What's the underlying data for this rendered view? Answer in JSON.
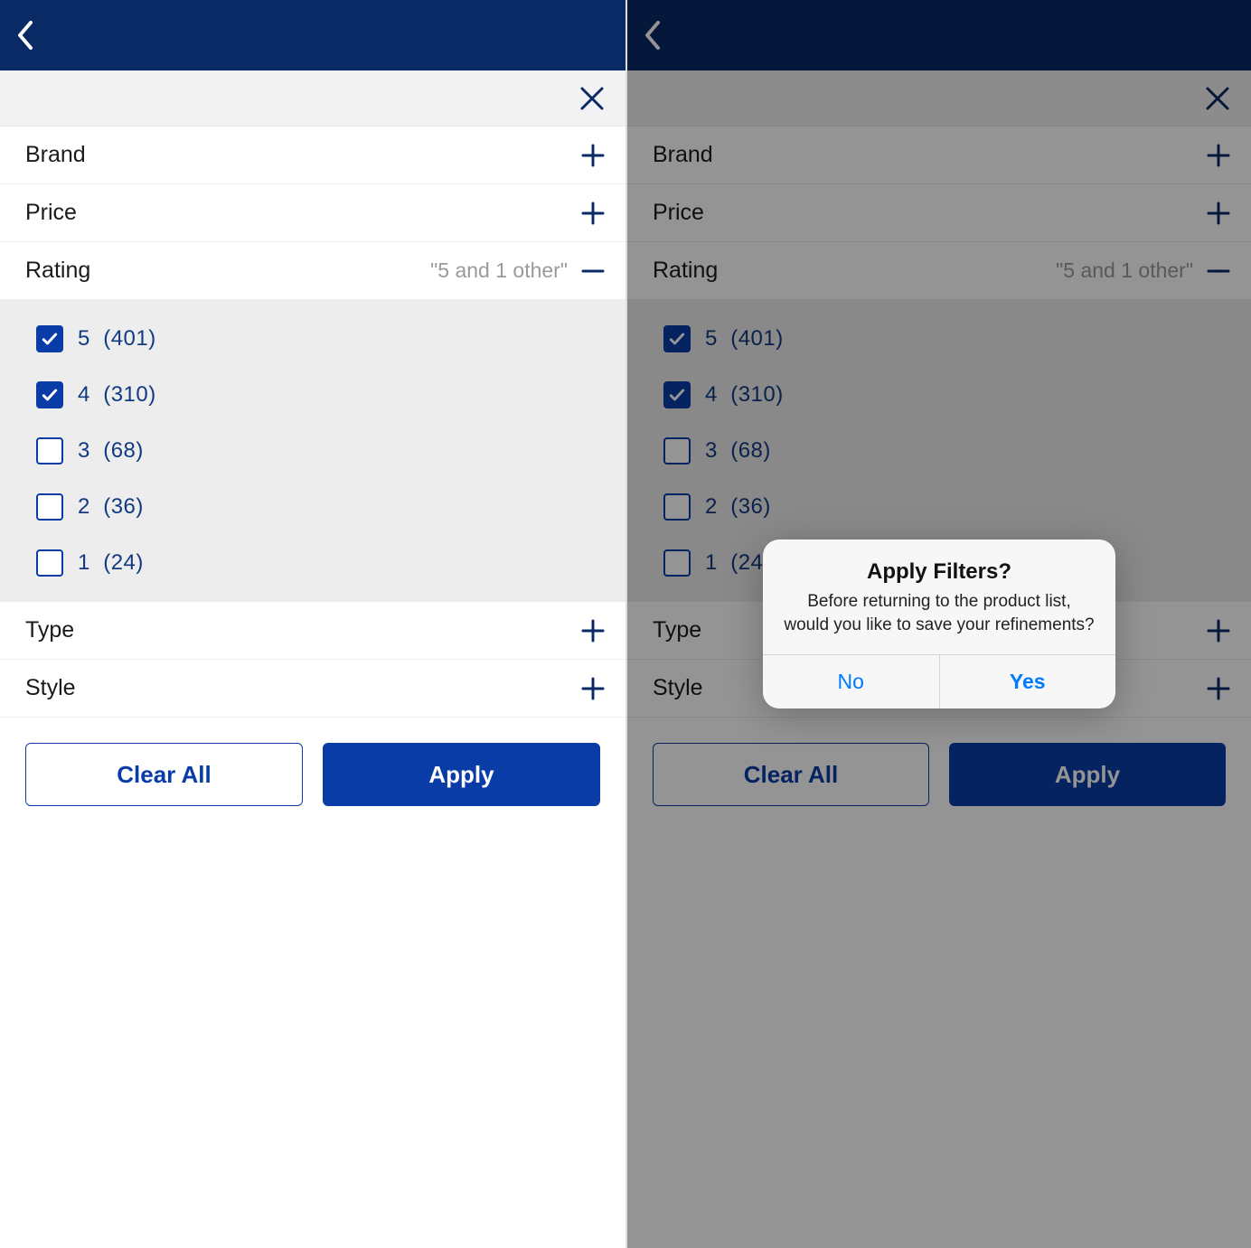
{
  "colors": {
    "navbar": "#0a2a66",
    "accent": "#0a3ca8",
    "ios_blue": "#007aff"
  },
  "filters": {
    "brand": {
      "label": "Brand"
    },
    "price": {
      "label": "Price"
    },
    "rating": {
      "label": "Rating",
      "summary": "\"5 and 1 other\"",
      "options": [
        {
          "label": "5",
          "count": "(401)",
          "checked": true
        },
        {
          "label": "4",
          "count": "(310)",
          "checked": true
        },
        {
          "label": "3",
          "count": "(68)",
          "checked": false
        },
        {
          "label": "2",
          "count": "(36)",
          "checked": false
        },
        {
          "label": "1",
          "count": "(24)",
          "checked": false
        }
      ]
    },
    "type": {
      "label": "Type"
    },
    "style": {
      "label": "Style"
    }
  },
  "buttons": {
    "clear": "Clear All",
    "apply": "Apply"
  },
  "alert": {
    "title": "Apply Filters?",
    "message": "Before returning to the product list, would you like to save your refinements?",
    "no": "No",
    "yes": "Yes"
  }
}
